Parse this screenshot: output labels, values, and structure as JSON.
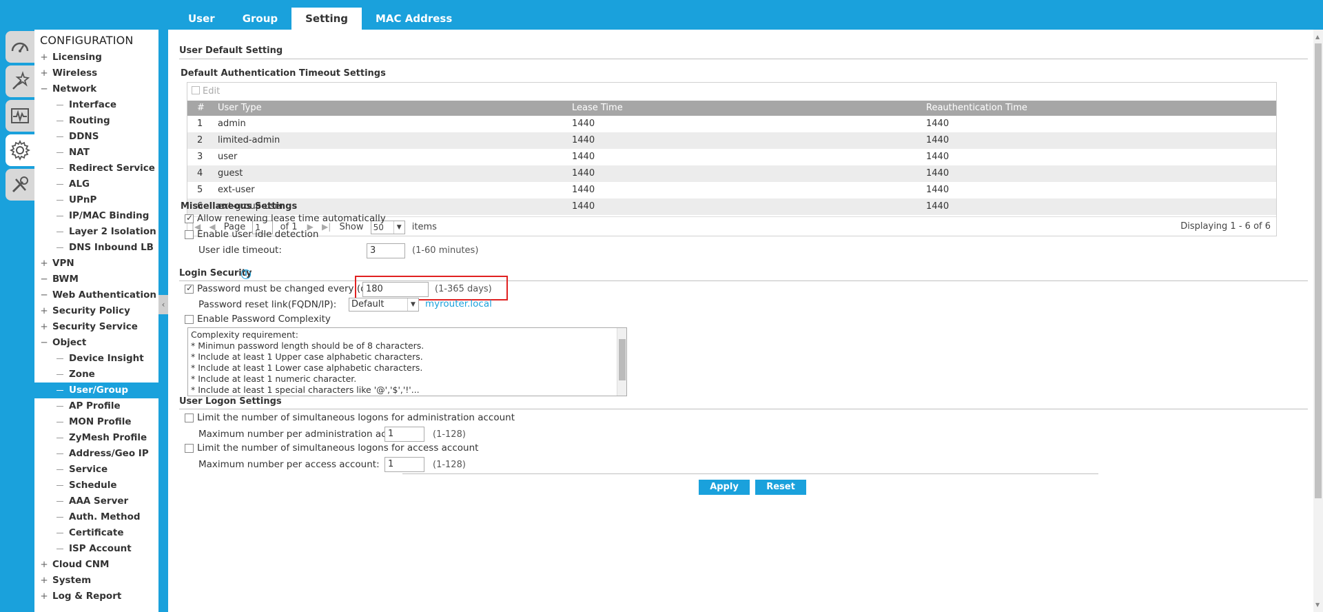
{
  "tabs": [
    {
      "label": "User"
    },
    {
      "label": "Group"
    },
    {
      "label": "Setting"
    },
    {
      "label": "MAC Address"
    }
  ],
  "nav": {
    "title": "CONFIGURATION",
    "items": [
      {
        "label": "Licensing",
        "exp": "+"
      },
      {
        "label": "Wireless",
        "exp": "+"
      },
      {
        "label": "Network",
        "exp": "−"
      },
      {
        "label": "Interface"
      },
      {
        "label": "Routing"
      },
      {
        "label": "DDNS"
      },
      {
        "label": "NAT"
      },
      {
        "label": "Redirect Service"
      },
      {
        "label": "ALG"
      },
      {
        "label": "UPnP"
      },
      {
        "label": "IP/MAC Binding"
      },
      {
        "label": "Layer 2 Isolation"
      },
      {
        "label": "DNS Inbound LB"
      },
      {
        "label": "VPN",
        "exp": "+"
      },
      {
        "label": "BWM",
        "exp": "−"
      },
      {
        "label": "Web Authentication",
        "exp": "−"
      },
      {
        "label": "Security Policy",
        "exp": "+"
      },
      {
        "label": "Security Service",
        "exp": "+"
      },
      {
        "label": "Object",
        "exp": "−"
      },
      {
        "label": "Device Insight"
      },
      {
        "label": "Zone"
      },
      {
        "label": "User/Group"
      },
      {
        "label": "AP Profile"
      },
      {
        "label": "MON Profile"
      },
      {
        "label": "ZyMesh Profile"
      },
      {
        "label": "Address/Geo IP"
      },
      {
        "label": "Service"
      },
      {
        "label": "Schedule"
      },
      {
        "label": "AAA Server"
      },
      {
        "label": "Auth. Method"
      },
      {
        "label": "Certificate"
      },
      {
        "label": "ISP Account"
      },
      {
        "label": "Cloud CNM",
        "exp": "+"
      },
      {
        "label": "System",
        "exp": "+"
      },
      {
        "label": "Log & Report",
        "exp": "+"
      }
    ]
  },
  "main": {
    "user_default_title": "User Default Setting",
    "timeout_title": "Default Authentication Timeout Settings",
    "edit_label": "Edit",
    "columns": [
      "#",
      "User Type",
      "Lease Time",
      "Reauthentication Time"
    ],
    "rows": [
      {
        "num": "1",
        "type": "admin",
        "lease": "1440",
        "reauth": "1440"
      },
      {
        "num": "2",
        "type": "limited-admin",
        "lease": "1440",
        "reauth": "1440"
      },
      {
        "num": "3",
        "type": "user",
        "lease": "1440",
        "reauth": "1440"
      },
      {
        "num": "4",
        "type": "guest",
        "lease": "1440",
        "reauth": "1440"
      },
      {
        "num": "5",
        "type": "ext-user",
        "lease": "1440",
        "reauth": "1440"
      },
      {
        "num": "6",
        "type": "ext-group-user",
        "lease": "1440",
        "reauth": "1440"
      }
    ],
    "pager": {
      "page_label": "Page",
      "page_value": "1",
      "of_label": "of 1",
      "show_label": "Show",
      "show_value": "50",
      "items_label": "items",
      "display": "Displaying 1 - 6 of 6"
    },
    "misc_title": "Miscellaneous Settings",
    "misc_renew": "Allow renewing lease time automatically",
    "misc_idle": "Enable user idle detection",
    "idle_timeout_label": "User idle timeout:",
    "idle_timeout_value": "3",
    "idle_timeout_hint": "(1-60 minutes)",
    "login_sec_title": "Login Security",
    "pwd_change_label": "Password must be changed every (days)",
    "pwd_change_value": "180",
    "pwd_change_hint": "(1-365 days)",
    "pwd_reset_label": "Password reset link(FQDN/IP):",
    "pwd_reset_value": "Default",
    "pwd_reset_link": "myrouter.local",
    "pwd_complex_label": "Enable Password Complexity",
    "complexity_lines": [
      "Complexity requirement:",
      "* Minimun password length should be of 8 characters.",
      "* Include at least 1 Upper case alphabetic characters.",
      "* Include at least 1 Lower case alphabetic characters.",
      "* Include at least 1 numeric character.",
      "* Include at least 1 special characters like '@','$','!'..."
    ],
    "logon_title": "User Logon Settings",
    "logon_admin_label": "Limit the number of simultaneous logons for administration account",
    "logon_admin_max_label": "Maximum number per administration account:",
    "logon_admin_max_value": "1",
    "logon_admin_hint": "(1-128)",
    "logon_access_label": "Limit the number of simultaneous logons for access account",
    "logon_access_max_label": "Maximum number per access account:",
    "logon_access_max_value": "1",
    "logon_access_hint": "(1-128)",
    "apply_label": "Apply",
    "reset_label": "Reset"
  },
  "colors": {
    "accent": "#1aa1dc",
    "highlight": "#e02020"
  }
}
